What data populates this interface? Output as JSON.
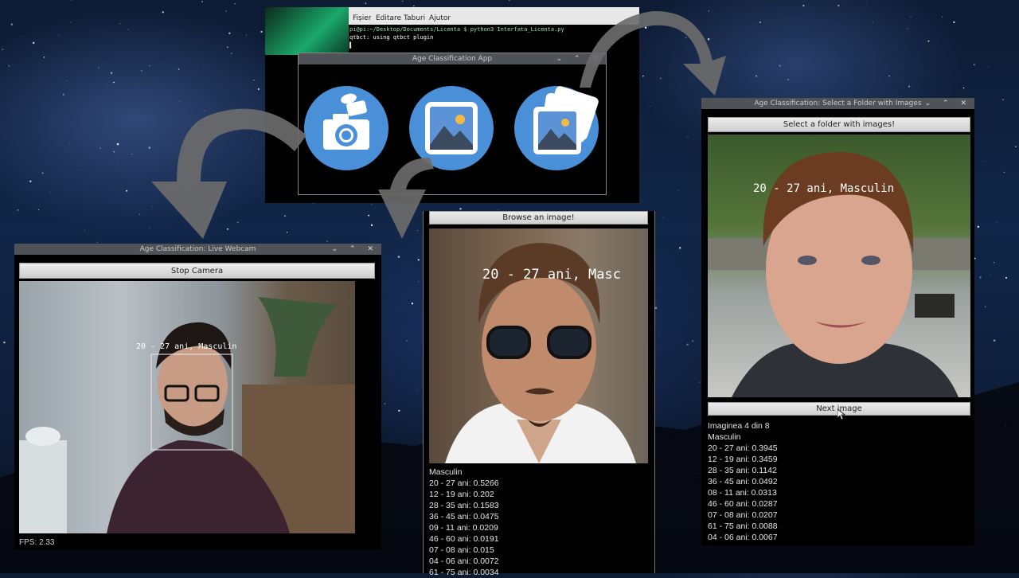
{
  "terminal": {
    "menu": [
      "Fișier",
      "Editare",
      "Taburi",
      "Ajutor"
    ],
    "command_line": "pi@pi:~/Desktop/Documents/Licenta $ python3 Interfata_Licenta.py",
    "output_line": "qtbct: using qtbct plugin",
    "cursor": "▌"
  },
  "main_app": {
    "title": "Age Classification App",
    "buttons": [
      {
        "icon": "camera-icon"
      },
      {
        "icon": "image-icon"
      },
      {
        "icon": "images-stack-icon"
      }
    ]
  },
  "webcam_window": {
    "title": "Age Classification: Live Webcam",
    "stop_button": "Stop Camera",
    "face_label": "20 - 27 ani, Masculin",
    "fps": "FPS: 2.33"
  },
  "browse_window": {
    "browse_button": "Browse an image!",
    "overlay_label": "20 - 27 ani, Masc",
    "gender": "Masculin",
    "results": [
      "20 - 27 ani: 0.5266",
      "12 - 19 ani: 0.202",
      "28 - 35 ani: 0.1583",
      "36 - 45 ani: 0.0475",
      "09 - 11 ani: 0.0209",
      "46 - 60 ani: 0.0191",
      "07 - 08 ani: 0.015",
      "04 - 06 ani: 0.0072",
      "61 - 75 ani: 0.0034"
    ]
  },
  "folder_window": {
    "title": "Age Classification: Select a Folder with Images",
    "select_button": "Select a folder with images!",
    "overlay_label": "20 - 27 ani, Masculin",
    "next_button": "Next image",
    "counter": "Imaginea 4 din 8",
    "gender": "Masculin",
    "results": [
      "20 - 27 ani: 0.3945",
      "12 - 19 ani: 0.3459",
      "28 - 35 ani: 0.1142",
      "36 - 45 ani: 0.0492",
      "08 - 11 ani: 0.0313",
      "46 - 60 ani: 0.0287",
      "07 - 08 ani: 0.0207",
      "61 - 75 ani: 0.0088",
      "04 - 06 ani: 0.0067"
    ]
  },
  "window_controls": "⌄ ⌃ ✕",
  "colors": {
    "accent_blue": "#4a90d9",
    "titlebar": "#4f5357",
    "terminal_green": "#3dd68c"
  }
}
